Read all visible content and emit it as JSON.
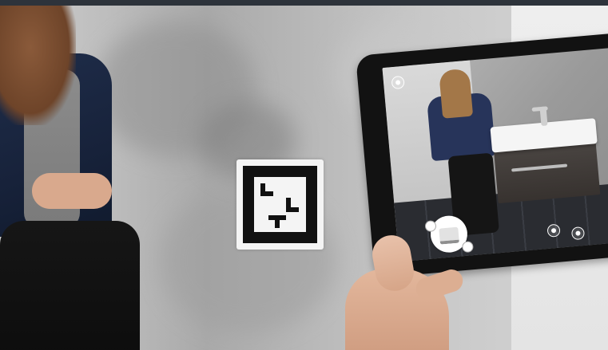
{
  "scene": {
    "description_kind": "photo",
    "subjects": [
      "woman",
      "ar-marker",
      "tablet",
      "hand",
      "bathroom-vanity-preview"
    ]
  },
  "colors": {
    "topbar": "#2d333b",
    "wall": "#b9b9b9",
    "blazer": "#1f2d4a",
    "tablet_bezel": "#121212",
    "vanity_cabinet": "#4a4542",
    "vanity_top": "#f5f5f5"
  },
  "icons": [
    "info-icon",
    "settings-icon",
    "arrow-left-icon",
    "arrow-right-icon",
    "product-thumbnail-icon"
  ]
}
